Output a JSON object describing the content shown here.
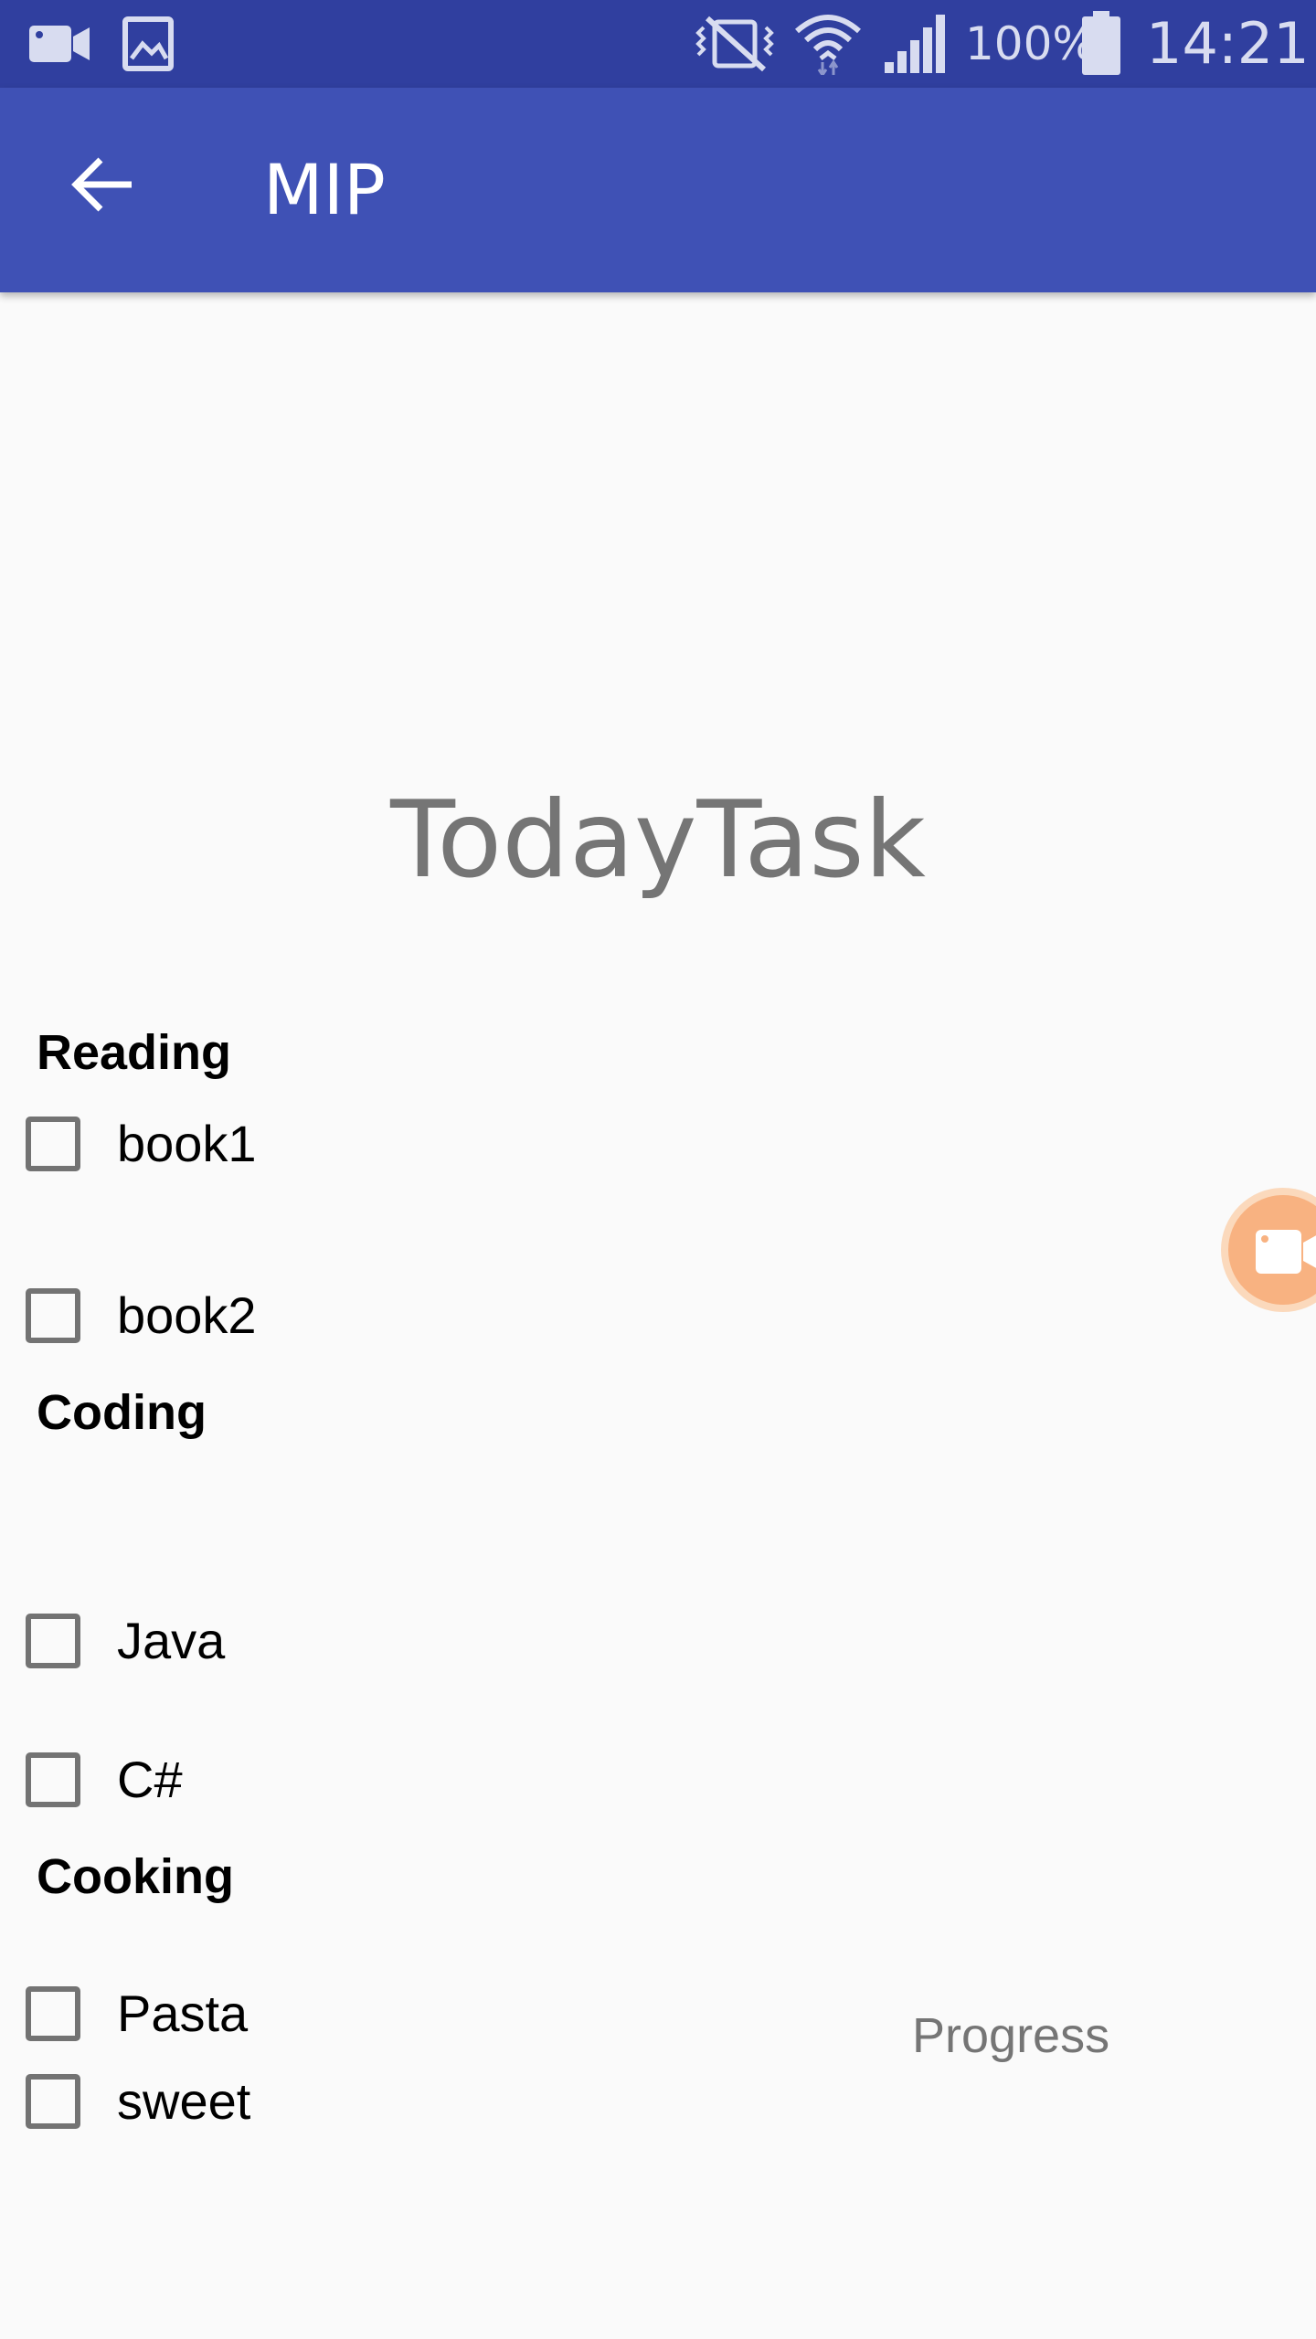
{
  "status_bar": {
    "battery": "100%",
    "time": "14:21",
    "icons": [
      "video-camera-icon",
      "image-icon",
      "vibrate-mute-icon",
      "wifi-icon",
      "signal-icon",
      "battery-icon"
    ]
  },
  "app_bar": {
    "title": "MIP",
    "back_icon": "back-arrow-icon"
  },
  "main": {
    "title": "TodayTask",
    "categories": [
      {
        "name": "Reading",
        "tasks": [
          {
            "label": "book1",
            "checked": false
          },
          {
            "label": "book2",
            "checked": false
          }
        ]
      },
      {
        "name": "Coding",
        "tasks": [
          {
            "label": "Java",
            "checked": false
          },
          {
            "label": "C#",
            "checked": false
          }
        ]
      },
      {
        "name": "Cooking",
        "tasks": [
          {
            "label": "Pasta",
            "checked": false
          },
          {
            "label": "sweet",
            "checked": false
          }
        ]
      }
    ],
    "progress_label": "Progress"
  },
  "floating_button": {
    "icon": "video-camera-icon"
  },
  "colors": {
    "status_bar": "#303f9f",
    "app_bar": "#3f51b5",
    "background": "#fafafa",
    "title_text": "#757575",
    "checkbox_border": "#737373",
    "floating_outer": "#fbd9bc",
    "floating_inner": "#f8b281"
  }
}
